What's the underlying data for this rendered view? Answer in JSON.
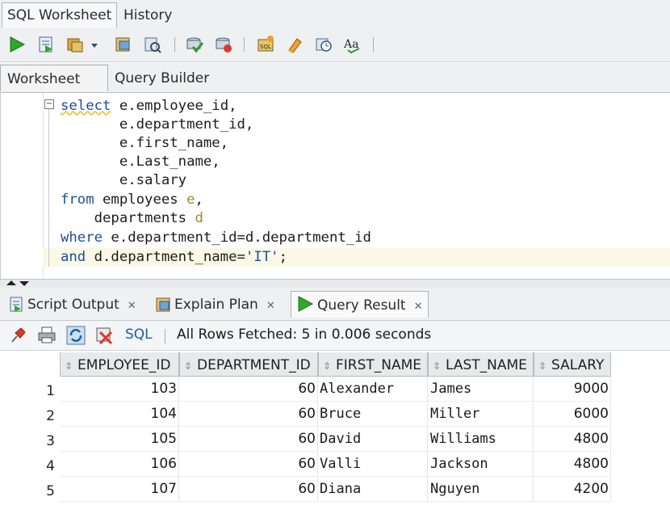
{
  "window": {
    "tabs": [
      {
        "label": "SQL Worksheet",
        "active": true
      },
      {
        "label": "History",
        "active": false
      }
    ]
  },
  "toolbar": {
    "icons": [
      "run-statement-icon",
      "run-script-icon",
      "autotrace-icon",
      "dropdown-arrow-icon",
      "explain-plan-icon",
      "sql-tuning-icon",
      "commit-icon",
      "rollback-icon",
      "unshared-sql-icon",
      "clear-icon",
      "sql-history-icon",
      "format-icon"
    ]
  },
  "worksheet_tabs": [
    {
      "label": "Worksheet",
      "active": true
    },
    {
      "label": "Query Builder",
      "active": false
    }
  ],
  "editor": {
    "lines": [
      {
        "kw": "select",
        "rest": " e.employee_id,"
      },
      {
        "kw": "",
        "rest": "       e.department_id,"
      },
      {
        "kw": "",
        "rest": "       e.first_name,"
      },
      {
        "kw": "",
        "rest": "       e.Last_name,"
      },
      {
        "kw": "",
        "rest": "       e.salary"
      },
      {
        "kw": "from",
        "rest": " employees ",
        "alias": "e",
        "tail": ","
      },
      {
        "kw": "",
        "rest": "    departments ",
        "alias": "d",
        "tail": ""
      },
      {
        "kw": "where",
        "rest": " e.department_id=d.department_id"
      },
      {
        "kw": "and",
        "rest": " d.department_name=",
        "str": "'IT'",
        "tail": ";"
      }
    ]
  },
  "bottom_tabs": [
    {
      "label": "Script Output",
      "icon": "script-output-icon",
      "active": false
    },
    {
      "label": "Explain Plan",
      "icon": "explain-plan-tab-icon",
      "active": false
    },
    {
      "label": "Query Result",
      "icon": "query-result-icon",
      "active": true
    }
  ],
  "result_toolbar": {
    "sql_label": "SQL",
    "status": "All Rows Fetched: 5 in 0.006 seconds"
  },
  "table": {
    "columns": [
      "EMPLOYEE_ID",
      "DEPARTMENT_ID",
      "FIRST_NAME",
      "LAST_NAME",
      "SALARY"
    ],
    "rows": [
      {
        "n": "1",
        "cells": [
          "103",
          "60",
          "Alexander",
          "James",
          "9000"
        ]
      },
      {
        "n": "2",
        "cells": [
          "104",
          "60",
          "Bruce",
          "Miller",
          "6000"
        ]
      },
      {
        "n": "3",
        "cells": [
          "105",
          "60",
          "David",
          "Williams",
          "4800"
        ]
      },
      {
        "n": "4",
        "cells": [
          "106",
          "60",
          "Valli",
          "Jackson",
          "4800"
        ]
      },
      {
        "n": "5",
        "cells": [
          "107",
          "60",
          "Diana",
          "Nguyen",
          "4200"
        ]
      }
    ]
  }
}
